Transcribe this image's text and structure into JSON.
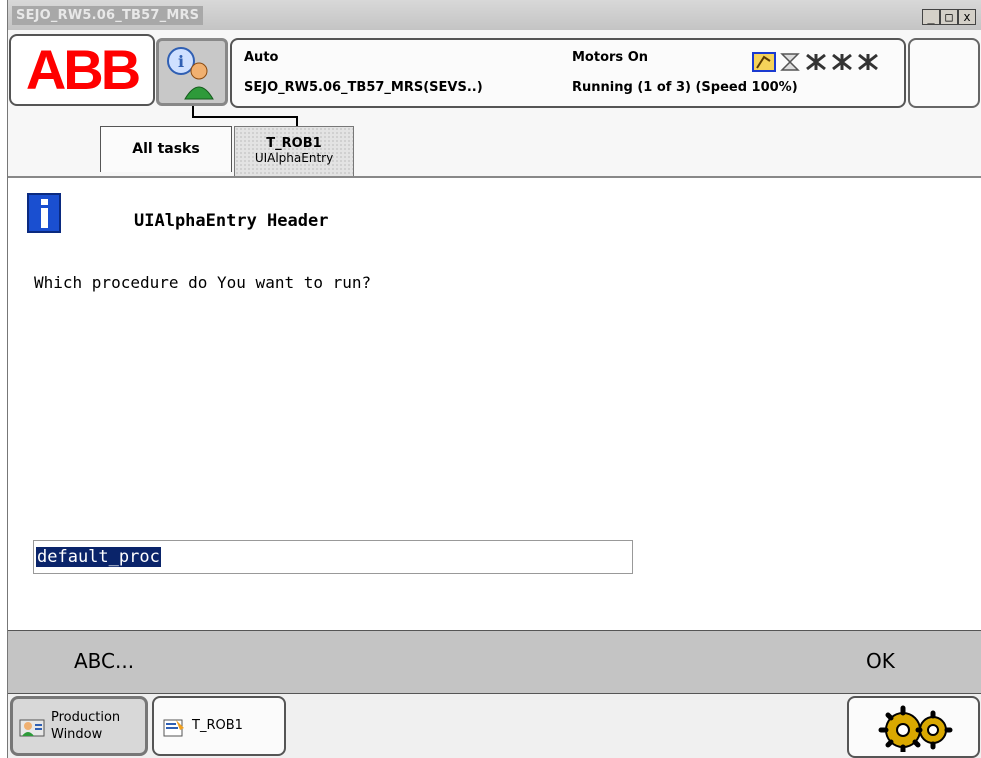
{
  "window": {
    "title": "SEJO_RW5.06_TB57_MRS",
    "minimize": "_",
    "maximize": "□",
    "close": "x"
  },
  "brand": {
    "logo_text": "ABB"
  },
  "status": {
    "mode": "Auto",
    "system": "SEJO_RW5.06_TB57_MRS(SEVS..)",
    "motors": "Motors On",
    "running": "Running (1 of 3) (Speed 100%)"
  },
  "tabs": [
    {
      "label": "All tasks"
    },
    {
      "label": "T_ROB1",
      "sublabel": "UIAlphaEntry"
    }
  ],
  "message": {
    "header": "UIAlphaEntry Header",
    "question": "Which procedure do You want to run?",
    "input_value": "default_proc"
  },
  "buttons": {
    "abc": "ABC...",
    "ok": "OK"
  },
  "taskbar": {
    "production_line1": "Production",
    "production_line2": "Window",
    "task": "T_ROB1"
  },
  "colors": {
    "abb_red": "#ff0000",
    "selection": "#0a246a",
    "info_blue": "#1a4fd0"
  },
  "icons": [
    "info-person-icon",
    "robot-status-icons",
    "info-icon",
    "production-window-icon",
    "task-icon",
    "gears-icon"
  ]
}
